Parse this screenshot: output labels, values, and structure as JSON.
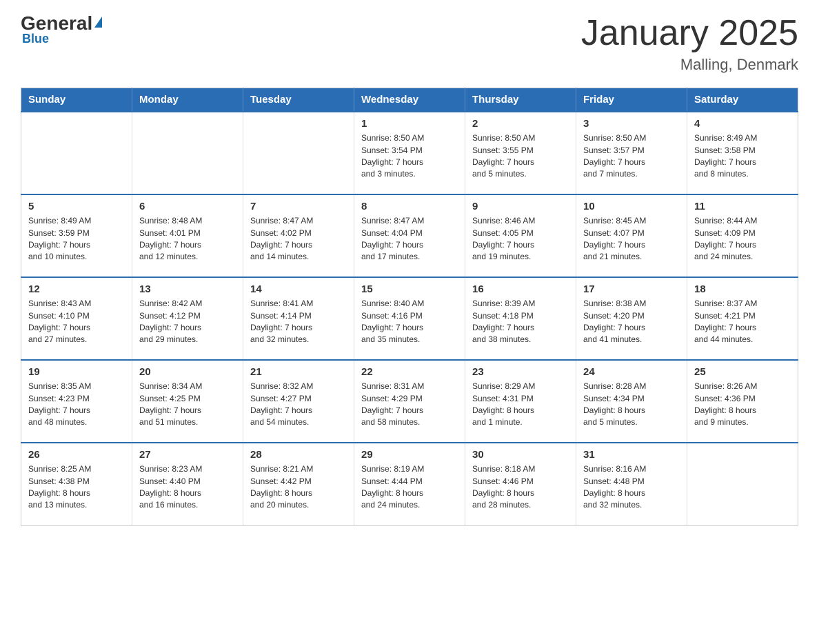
{
  "logo": {
    "general": "General",
    "blue": "Blue",
    "triangle_label": "logo-triangle"
  },
  "header": {
    "title": "January 2025",
    "subtitle": "Malling, Denmark"
  },
  "weekdays": [
    "Sunday",
    "Monday",
    "Tuesday",
    "Wednesday",
    "Thursday",
    "Friday",
    "Saturday"
  ],
  "weeks": [
    [
      {
        "day": "",
        "info": ""
      },
      {
        "day": "",
        "info": ""
      },
      {
        "day": "",
        "info": ""
      },
      {
        "day": "1",
        "info": "Sunrise: 8:50 AM\nSunset: 3:54 PM\nDaylight: 7 hours\nand 3 minutes."
      },
      {
        "day": "2",
        "info": "Sunrise: 8:50 AM\nSunset: 3:55 PM\nDaylight: 7 hours\nand 5 minutes."
      },
      {
        "day": "3",
        "info": "Sunrise: 8:50 AM\nSunset: 3:57 PM\nDaylight: 7 hours\nand 7 minutes."
      },
      {
        "day": "4",
        "info": "Sunrise: 8:49 AM\nSunset: 3:58 PM\nDaylight: 7 hours\nand 8 minutes."
      }
    ],
    [
      {
        "day": "5",
        "info": "Sunrise: 8:49 AM\nSunset: 3:59 PM\nDaylight: 7 hours\nand 10 minutes."
      },
      {
        "day": "6",
        "info": "Sunrise: 8:48 AM\nSunset: 4:01 PM\nDaylight: 7 hours\nand 12 minutes."
      },
      {
        "day": "7",
        "info": "Sunrise: 8:47 AM\nSunset: 4:02 PM\nDaylight: 7 hours\nand 14 minutes."
      },
      {
        "day": "8",
        "info": "Sunrise: 8:47 AM\nSunset: 4:04 PM\nDaylight: 7 hours\nand 17 minutes."
      },
      {
        "day": "9",
        "info": "Sunrise: 8:46 AM\nSunset: 4:05 PM\nDaylight: 7 hours\nand 19 minutes."
      },
      {
        "day": "10",
        "info": "Sunrise: 8:45 AM\nSunset: 4:07 PM\nDaylight: 7 hours\nand 21 minutes."
      },
      {
        "day": "11",
        "info": "Sunrise: 8:44 AM\nSunset: 4:09 PM\nDaylight: 7 hours\nand 24 minutes."
      }
    ],
    [
      {
        "day": "12",
        "info": "Sunrise: 8:43 AM\nSunset: 4:10 PM\nDaylight: 7 hours\nand 27 minutes."
      },
      {
        "day": "13",
        "info": "Sunrise: 8:42 AM\nSunset: 4:12 PM\nDaylight: 7 hours\nand 29 minutes."
      },
      {
        "day": "14",
        "info": "Sunrise: 8:41 AM\nSunset: 4:14 PM\nDaylight: 7 hours\nand 32 minutes."
      },
      {
        "day": "15",
        "info": "Sunrise: 8:40 AM\nSunset: 4:16 PM\nDaylight: 7 hours\nand 35 minutes."
      },
      {
        "day": "16",
        "info": "Sunrise: 8:39 AM\nSunset: 4:18 PM\nDaylight: 7 hours\nand 38 minutes."
      },
      {
        "day": "17",
        "info": "Sunrise: 8:38 AM\nSunset: 4:20 PM\nDaylight: 7 hours\nand 41 minutes."
      },
      {
        "day": "18",
        "info": "Sunrise: 8:37 AM\nSunset: 4:21 PM\nDaylight: 7 hours\nand 44 minutes."
      }
    ],
    [
      {
        "day": "19",
        "info": "Sunrise: 8:35 AM\nSunset: 4:23 PM\nDaylight: 7 hours\nand 48 minutes."
      },
      {
        "day": "20",
        "info": "Sunrise: 8:34 AM\nSunset: 4:25 PM\nDaylight: 7 hours\nand 51 minutes."
      },
      {
        "day": "21",
        "info": "Sunrise: 8:32 AM\nSunset: 4:27 PM\nDaylight: 7 hours\nand 54 minutes."
      },
      {
        "day": "22",
        "info": "Sunrise: 8:31 AM\nSunset: 4:29 PM\nDaylight: 7 hours\nand 58 minutes."
      },
      {
        "day": "23",
        "info": "Sunrise: 8:29 AM\nSunset: 4:31 PM\nDaylight: 8 hours\nand 1 minute."
      },
      {
        "day": "24",
        "info": "Sunrise: 8:28 AM\nSunset: 4:34 PM\nDaylight: 8 hours\nand 5 minutes."
      },
      {
        "day": "25",
        "info": "Sunrise: 8:26 AM\nSunset: 4:36 PM\nDaylight: 8 hours\nand 9 minutes."
      }
    ],
    [
      {
        "day": "26",
        "info": "Sunrise: 8:25 AM\nSunset: 4:38 PM\nDaylight: 8 hours\nand 13 minutes."
      },
      {
        "day": "27",
        "info": "Sunrise: 8:23 AM\nSunset: 4:40 PM\nDaylight: 8 hours\nand 16 minutes."
      },
      {
        "day": "28",
        "info": "Sunrise: 8:21 AM\nSunset: 4:42 PM\nDaylight: 8 hours\nand 20 minutes."
      },
      {
        "day": "29",
        "info": "Sunrise: 8:19 AM\nSunset: 4:44 PM\nDaylight: 8 hours\nand 24 minutes."
      },
      {
        "day": "30",
        "info": "Sunrise: 8:18 AM\nSunset: 4:46 PM\nDaylight: 8 hours\nand 28 minutes."
      },
      {
        "day": "31",
        "info": "Sunrise: 8:16 AM\nSunset: 4:48 PM\nDaylight: 8 hours\nand 32 minutes."
      },
      {
        "day": "",
        "info": ""
      }
    ]
  ]
}
